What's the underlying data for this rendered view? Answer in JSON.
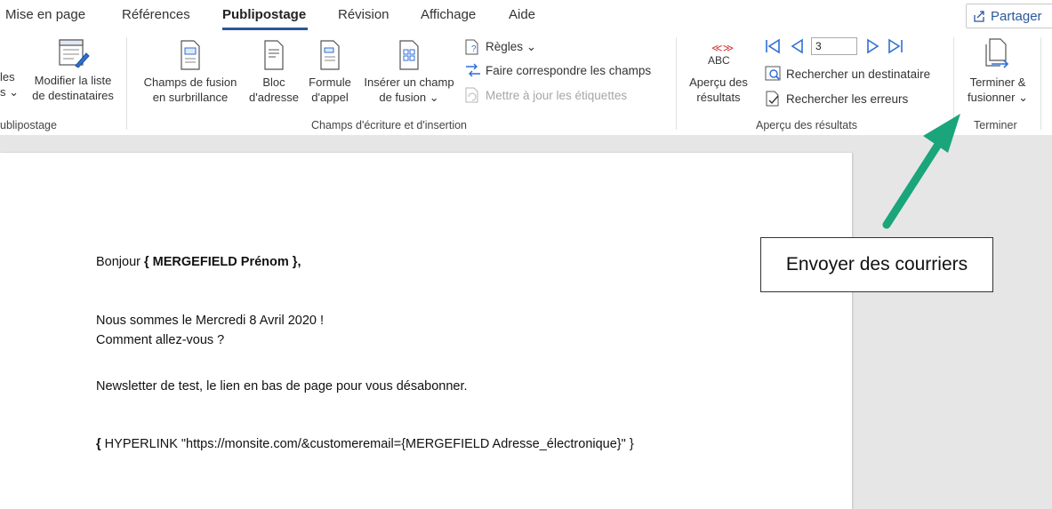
{
  "tabs": {
    "mise_en_page": "Mise en page",
    "references": "Références",
    "publipostage": "Publipostage",
    "revision": "Révision",
    "affichage": "Affichage",
    "aide": "Aide"
  },
  "share": {
    "label": "Partager"
  },
  "ribbon": {
    "partial_left_top": "les",
    "partial_left_bottom": "s ⌄",
    "modify_list_line1": "Modifier la liste",
    "modify_list_line2": "de destinataires",
    "group_publipostage": "ublipostage",
    "highlight_line1": "Champs de fusion",
    "highlight_line2": "en surbrillance",
    "address_line1": "Bloc",
    "address_line2": "d'adresse",
    "greeting_line1": "Formule",
    "greeting_line2": "d'appel",
    "insert_line1": "Insérer un champ",
    "insert_line2": "de fusion ⌄",
    "rules": "Règles ⌄",
    "match_fields": "Faire correspondre les champs",
    "update_labels": "Mettre à jour les étiquettes",
    "group_champs": "Champs d'écriture et d'insertion",
    "abc_icon_text": "ABC",
    "preview_line1": "Aperçu des",
    "preview_line2": "résultats",
    "record_number": "3",
    "find_recipient": "Rechercher un destinataire",
    "check_errors": "Rechercher les erreurs",
    "group_apercu": "Aperçu des résultats",
    "finish_line1": "Terminer &",
    "finish_line2": "fusionner ⌄",
    "group_terminer": "Terminer"
  },
  "document": {
    "greeting_prefix": "Bonjour ",
    "greeting_field": "{ MERGEFIELD Prénom }",
    "greeting_suffix": ",",
    "date_line": "Nous sommes le Mercredi 8 Avril 2020 !",
    "question_line": "Comment allez-vous ?",
    "newsletter_line": "Newsletter de test, le lien en bas de page pour vous désabonner.",
    "hyperlink_open": "{ ",
    "hyperlink_text": "HYPERLINK \"https://monsite.com/&customeremail=",
    "hyperlink_field": "{MERGEFIELD Adresse_électronique}",
    "hyperlink_close": "\" }"
  },
  "callout": {
    "text": "Envoyer des courriers"
  },
  "colors": {
    "accent": "#2b579a",
    "arrow": "#1aa57a",
    "nav_blue": "#2f6fd6",
    "abc_red": "#d83b3b"
  }
}
